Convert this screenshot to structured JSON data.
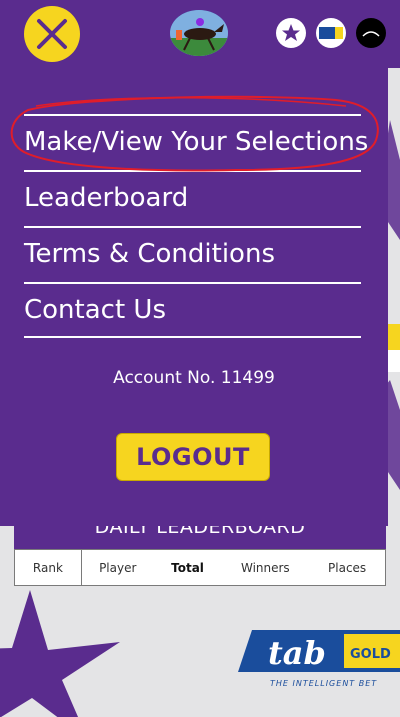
{
  "header": {
    "close_icon": "close-icon",
    "logo_icon": "racehorse-logo-icon",
    "sponsors": [
      "star-sponsor-icon",
      "tab-sponsor-icon",
      "black-sponsor-icon"
    ]
  },
  "menu": {
    "items": [
      {
        "label": "Make/View Your Selections"
      },
      {
        "label": "Leaderboard"
      },
      {
        "label": "Terms & Conditions"
      },
      {
        "label": "Contact Us"
      }
    ],
    "account": "Account No. 11499",
    "logout": "LOGOUT"
  },
  "leaderboard": {
    "title": "DAILY LEADERBOARD",
    "columns": [
      "Rank",
      "Player",
      "Total",
      "Winners",
      "Places"
    ]
  },
  "colors": {
    "purple": "#5a2c8e",
    "yellow": "#f6d51f",
    "annotation_red": "#e01d2a"
  }
}
